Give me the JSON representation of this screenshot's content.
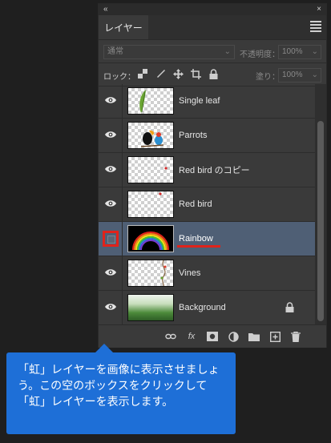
{
  "panel": {
    "topbar": {
      "collapse_glyph": "«",
      "close_glyph": "×"
    },
    "tab_label": "レイヤー",
    "blend_mode": "通常",
    "opacity_label": "不透明度：",
    "opacity_value": "100%",
    "lock_label": "ロック：",
    "fill_label": "塗り：",
    "fill_value": "100%",
    "layers": [
      {
        "name": "Single leaf",
        "visible": true,
        "thumb": "checker"
      },
      {
        "name": "Parrots",
        "visible": true,
        "thumb": "checker"
      },
      {
        "name": "Red bird のコピー",
        "visible": true,
        "thumb": "checker"
      },
      {
        "name": "Red bird",
        "visible": true,
        "thumb": "checker"
      },
      {
        "name": "Rainbow",
        "visible": false,
        "thumb": "black",
        "selected": true
      },
      {
        "name": "Vines",
        "visible": true,
        "thumb": "checker"
      },
      {
        "name": "Background",
        "visible": true,
        "thumb": "landscape",
        "locked": true
      }
    ],
    "bottom_icons": [
      "link-icon",
      "fx-icon",
      "mask-icon",
      "adjustment-icon",
      "folder-icon",
      "new-layer-icon",
      "trash-icon"
    ],
    "fx_label": "fx"
  },
  "tooltip": {
    "text": "「虹」レイヤーを画像に表示させましょう。この空のボックスをクリックして「虹」レイヤーを表示します。"
  },
  "colors": {
    "panel_bg": "#3a3a3a",
    "selected_row": "#4f5f75",
    "highlight_red": "#e0231b",
    "tooltip_blue": "#1e6fd7"
  }
}
